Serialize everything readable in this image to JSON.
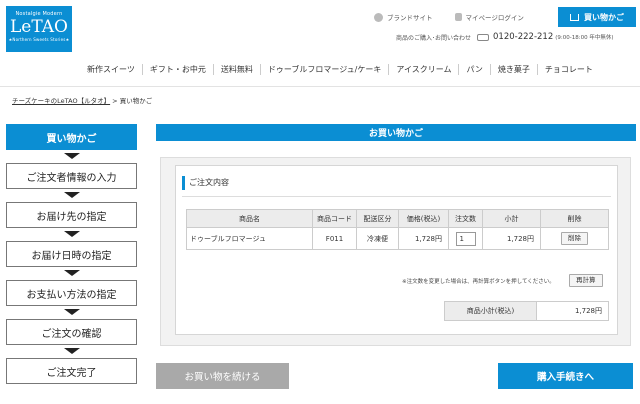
{
  "logo": {
    "line1": "Nostalgie Modern",
    "brand": "LeTAO",
    "line3": "★Northern Sweets Stories★"
  },
  "header": {
    "brand_site": "ブランドサイト",
    "mypage": "マイページログイン",
    "cart": "買い物かご",
    "phone_label": "商品のご購入･お問い合わせ",
    "phone_number": "0120-222-212",
    "phone_hours": "(9:00-18:00 年中無休)"
  },
  "nav": [
    "新作スイーツ",
    "ギフト・お中元",
    "送料無料",
    "ドゥーブルフロマージュ/ケーキ",
    "アイスクリーム",
    "パン",
    "焼き菓子",
    "チョコレート"
  ],
  "breadcrumb": {
    "link": "チーズケーキのLeTAO【ルタオ】",
    "separator": " > ",
    "current": "買い物かご"
  },
  "steps": [
    "買い物かご",
    "ご注文者情報の入力",
    "お届け先の指定",
    "お届け日時の指定",
    "お支払い方法の指定",
    "ご注文の確認",
    "ご注文完了"
  ],
  "main": {
    "title": "お買い物かご",
    "section_title": "ご注文内容",
    "columns": [
      "商品名",
      "商品コード",
      "配送区分",
      "価格(税込)",
      "注文数",
      "小計",
      "削除"
    ],
    "rows": [
      {
        "name": "ドゥーブルフロマージュ",
        "code": "F011",
        "delivery": "冷凍便",
        "price": "1,728円",
        "qty": "1",
        "subtotal": "1,728円",
        "delete": "削除"
      }
    ],
    "note": "※注文数を変更した場合は、再計算ボタンを押してください。",
    "recalc": "再計算",
    "subtotal_label": "商品小計(税込)",
    "subtotal_value": "1,728円"
  },
  "actions": {
    "continue": "お買い物を続ける",
    "checkout": "購入手続きへ"
  },
  "colors": {
    "accent": "#0b8ed3",
    "continue_bg": "#a9a9a9"
  }
}
